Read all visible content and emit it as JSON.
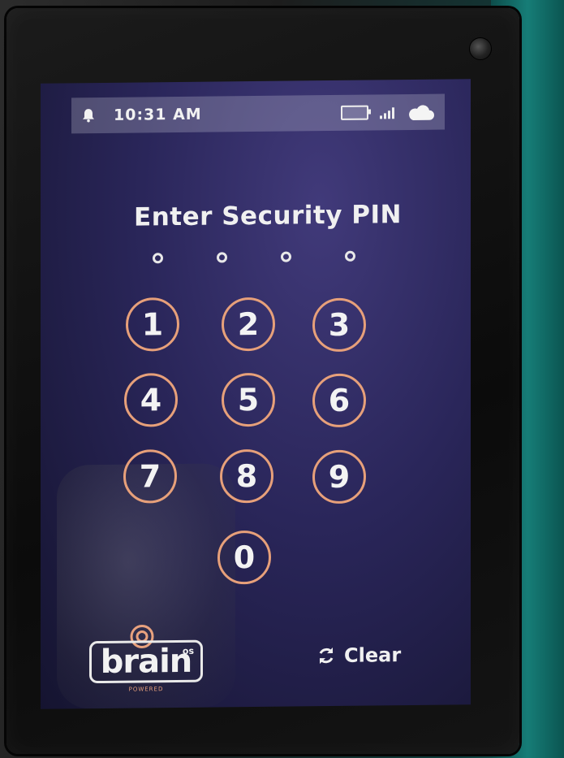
{
  "status_bar": {
    "time": "10:31 AM",
    "bell_icon": "bell-icon",
    "battery_icon": "battery-icon",
    "signal_icon": "signal-icon",
    "cloud_icon": "cloud-icon"
  },
  "title": "Enter Security PIN",
  "pin": {
    "length": 4,
    "entered": 0
  },
  "keypad": {
    "keys": [
      "1",
      "2",
      "3",
      "4",
      "5",
      "6",
      "7",
      "8",
      "9",
      "0"
    ]
  },
  "brand": {
    "word": "brain",
    "superscript": "os",
    "tagline": "POWERED"
  },
  "actions": {
    "clear_label": "Clear",
    "clear_icon": "refresh-icon"
  },
  "colors": {
    "key_ring": "#e7a07a",
    "text": "#f0f0f0",
    "screen_bg": "#2a265a"
  }
}
